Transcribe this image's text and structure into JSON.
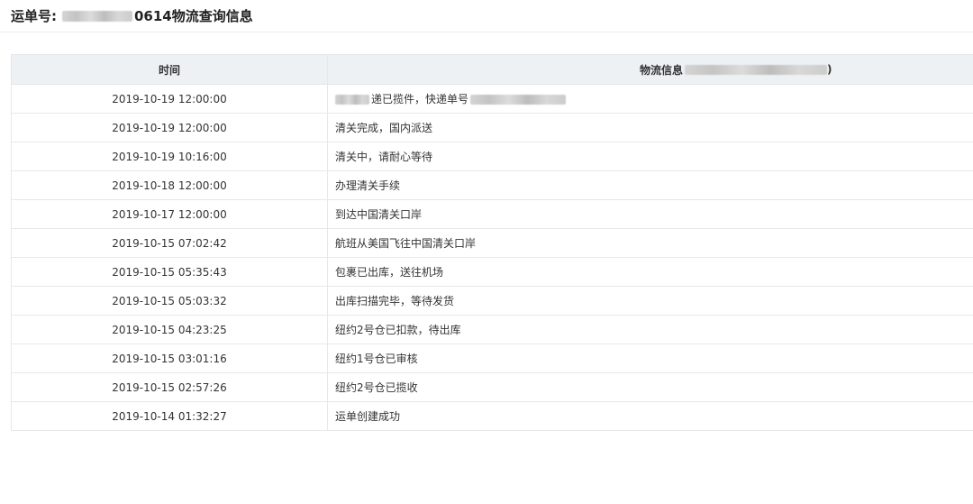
{
  "header": {
    "title_prefix": "运单号:",
    "title_suffix": "0614物流查询信息"
  },
  "table": {
    "columns": {
      "time": "时间",
      "info": "物流信息",
      "info_suffix": ")"
    },
    "rows": [
      {
        "time": "2019-10-19 12:00:00",
        "info_main": "递已揽件，快递单号"
      },
      {
        "time": "2019-10-19 12:00:00",
        "info": "清关完成，国内派送"
      },
      {
        "time": "2019-10-19 10:16:00",
        "info": "清关中，请耐心等待"
      },
      {
        "time": "2019-10-18 12:00:00",
        "info": "办理清关手续"
      },
      {
        "time": "2019-10-17 12:00:00",
        "info": "到达中国清关口岸"
      },
      {
        "time": "2019-10-15 07:02:42",
        "info": "航班从美国飞往中国清关口岸"
      },
      {
        "time": "2019-10-15 05:35:43",
        "info": "包裹已出库，送往机场"
      },
      {
        "time": "2019-10-15 05:03:32",
        "info": "出库扫描完毕，等待发货"
      },
      {
        "time": "2019-10-15 04:23:25",
        "info": "纽约2号仓已扣款，待出库"
      },
      {
        "time": "2019-10-15 03:01:16",
        "info": "纽约1号仓已审核"
      },
      {
        "time": "2019-10-15 02:57:26",
        "info": "纽约2号仓已揽收"
      },
      {
        "time": "2019-10-14 01:32:27",
        "info": "运单创建成功"
      }
    ]
  }
}
